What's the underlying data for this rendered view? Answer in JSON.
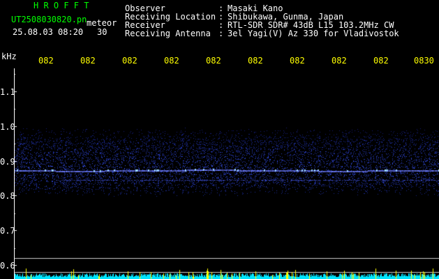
{
  "header": {
    "app_title": "H R O F F T",
    "filename": "UT2508030820.pn",
    "mode": "meteor",
    "datetime": "25.08.03 08:20",
    "interval": "30",
    "labels": [
      "Observer",
      "Receiving Location",
      "Receiver",
      "Receiving Antenna"
    ],
    "separators": [
      ":",
      ":",
      ":",
      ":"
    ],
    "values": [
      "Masaki Kano",
      "Shibukawa, Gunma, Japan",
      "RTL-SDR SDR# 43dB L15 103.2MHz CW",
      "3el Yagi(V) Az 330 for Vladivostok"
    ]
  },
  "axis": {
    "y_unit": "kHz",
    "y_ticks": [
      "1.1",
      "1.0",
      "0.9",
      "0.8",
      "0.7",
      "0.6"
    ],
    "x_ticks": [
      "082",
      "082",
      "082",
      "082",
      "082",
      "082",
      "082",
      "082",
      "082",
      "0830"
    ]
  },
  "colors": {
    "background": "#000000",
    "title": "#00ff00",
    "time_labels": "#ffff00",
    "noise": "#2a3cff",
    "band": "#6f7dff",
    "baseline": "#00e5ff",
    "spikes": "#ffff00"
  }
}
